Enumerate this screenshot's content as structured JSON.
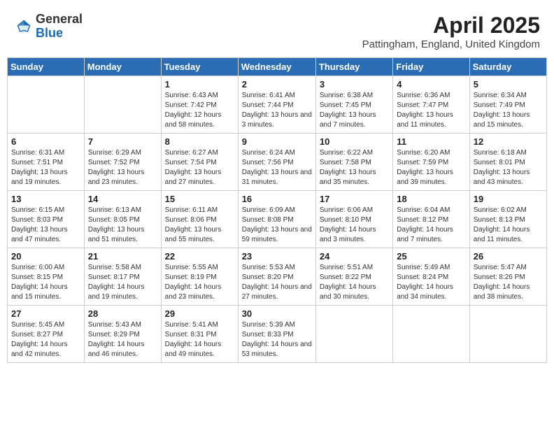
{
  "header": {
    "logo_general": "General",
    "logo_blue": "Blue",
    "month_title": "April 2025",
    "location": "Pattingham, England, United Kingdom"
  },
  "weekdays": [
    "Sunday",
    "Monday",
    "Tuesday",
    "Wednesday",
    "Thursday",
    "Friday",
    "Saturday"
  ],
  "weeks": [
    [
      {
        "day": "",
        "info": ""
      },
      {
        "day": "",
        "info": ""
      },
      {
        "day": "1",
        "info": "Sunrise: 6:43 AM\nSunset: 7:42 PM\nDaylight: 12 hours and 58 minutes."
      },
      {
        "day": "2",
        "info": "Sunrise: 6:41 AM\nSunset: 7:44 PM\nDaylight: 13 hours and 3 minutes."
      },
      {
        "day": "3",
        "info": "Sunrise: 6:38 AM\nSunset: 7:45 PM\nDaylight: 13 hours and 7 minutes."
      },
      {
        "day": "4",
        "info": "Sunrise: 6:36 AM\nSunset: 7:47 PM\nDaylight: 13 hours and 11 minutes."
      },
      {
        "day": "5",
        "info": "Sunrise: 6:34 AM\nSunset: 7:49 PM\nDaylight: 13 hours and 15 minutes."
      }
    ],
    [
      {
        "day": "6",
        "info": "Sunrise: 6:31 AM\nSunset: 7:51 PM\nDaylight: 13 hours and 19 minutes."
      },
      {
        "day": "7",
        "info": "Sunrise: 6:29 AM\nSunset: 7:52 PM\nDaylight: 13 hours and 23 minutes."
      },
      {
        "day": "8",
        "info": "Sunrise: 6:27 AM\nSunset: 7:54 PM\nDaylight: 13 hours and 27 minutes."
      },
      {
        "day": "9",
        "info": "Sunrise: 6:24 AM\nSunset: 7:56 PM\nDaylight: 13 hours and 31 minutes."
      },
      {
        "day": "10",
        "info": "Sunrise: 6:22 AM\nSunset: 7:58 PM\nDaylight: 13 hours and 35 minutes."
      },
      {
        "day": "11",
        "info": "Sunrise: 6:20 AM\nSunset: 7:59 PM\nDaylight: 13 hours and 39 minutes."
      },
      {
        "day": "12",
        "info": "Sunrise: 6:18 AM\nSunset: 8:01 PM\nDaylight: 13 hours and 43 minutes."
      }
    ],
    [
      {
        "day": "13",
        "info": "Sunrise: 6:15 AM\nSunset: 8:03 PM\nDaylight: 13 hours and 47 minutes."
      },
      {
        "day": "14",
        "info": "Sunrise: 6:13 AM\nSunset: 8:05 PM\nDaylight: 13 hours and 51 minutes."
      },
      {
        "day": "15",
        "info": "Sunrise: 6:11 AM\nSunset: 8:06 PM\nDaylight: 13 hours and 55 minutes."
      },
      {
        "day": "16",
        "info": "Sunrise: 6:09 AM\nSunset: 8:08 PM\nDaylight: 13 hours and 59 minutes."
      },
      {
        "day": "17",
        "info": "Sunrise: 6:06 AM\nSunset: 8:10 PM\nDaylight: 14 hours and 3 minutes."
      },
      {
        "day": "18",
        "info": "Sunrise: 6:04 AM\nSunset: 8:12 PM\nDaylight: 14 hours and 7 minutes."
      },
      {
        "day": "19",
        "info": "Sunrise: 6:02 AM\nSunset: 8:13 PM\nDaylight: 14 hours and 11 minutes."
      }
    ],
    [
      {
        "day": "20",
        "info": "Sunrise: 6:00 AM\nSunset: 8:15 PM\nDaylight: 14 hours and 15 minutes."
      },
      {
        "day": "21",
        "info": "Sunrise: 5:58 AM\nSunset: 8:17 PM\nDaylight: 14 hours and 19 minutes."
      },
      {
        "day": "22",
        "info": "Sunrise: 5:55 AM\nSunset: 8:19 PM\nDaylight: 14 hours and 23 minutes."
      },
      {
        "day": "23",
        "info": "Sunrise: 5:53 AM\nSunset: 8:20 PM\nDaylight: 14 hours and 27 minutes."
      },
      {
        "day": "24",
        "info": "Sunrise: 5:51 AM\nSunset: 8:22 PM\nDaylight: 14 hours and 30 minutes."
      },
      {
        "day": "25",
        "info": "Sunrise: 5:49 AM\nSunset: 8:24 PM\nDaylight: 14 hours and 34 minutes."
      },
      {
        "day": "26",
        "info": "Sunrise: 5:47 AM\nSunset: 8:26 PM\nDaylight: 14 hours and 38 minutes."
      }
    ],
    [
      {
        "day": "27",
        "info": "Sunrise: 5:45 AM\nSunset: 8:27 PM\nDaylight: 14 hours and 42 minutes."
      },
      {
        "day": "28",
        "info": "Sunrise: 5:43 AM\nSunset: 8:29 PM\nDaylight: 14 hours and 46 minutes."
      },
      {
        "day": "29",
        "info": "Sunrise: 5:41 AM\nSunset: 8:31 PM\nDaylight: 14 hours and 49 minutes."
      },
      {
        "day": "30",
        "info": "Sunrise: 5:39 AM\nSunset: 8:33 PM\nDaylight: 14 hours and 53 minutes."
      },
      {
        "day": "",
        "info": ""
      },
      {
        "day": "",
        "info": ""
      },
      {
        "day": "",
        "info": ""
      }
    ]
  ]
}
